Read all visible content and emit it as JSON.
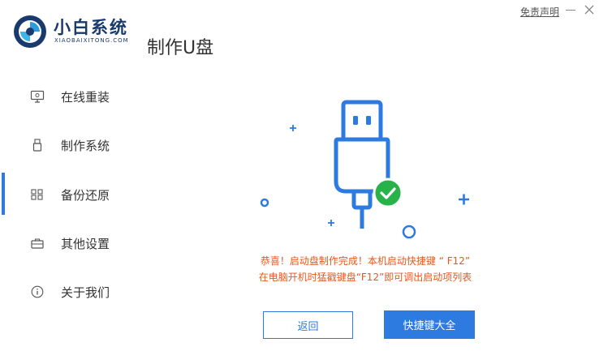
{
  "brand": {
    "name": "小白系统",
    "subtitle": "XIAOBAIXITONG.COM"
  },
  "page_title": "制作U盘",
  "window": {
    "disclaimer": "免责声明"
  },
  "sidebar": {
    "items": [
      {
        "label": "在线重装",
        "icon": "monitor-icon"
      },
      {
        "label": "制作系统",
        "icon": "usb-drive-icon"
      },
      {
        "label": "备份还原",
        "icon": "grid-icon",
        "active": true
      },
      {
        "label": "其他设置",
        "icon": "briefcase-icon"
      },
      {
        "label": "关于我们",
        "icon": "info-icon"
      }
    ]
  },
  "content": {
    "message_line1": "恭喜！启动盘制作完成！本机启动快捷键 “ F12”",
    "message_line2": "在电脑开机时猛戳键盘“F12”即可调出启动项列表",
    "back_label": "返回",
    "hotkeys_label": "快捷键大全"
  },
  "colors": {
    "accent": "#2d7ae0",
    "message": "#e8581c",
    "success": "#27b24a",
    "brand": "#1a3a6e"
  }
}
